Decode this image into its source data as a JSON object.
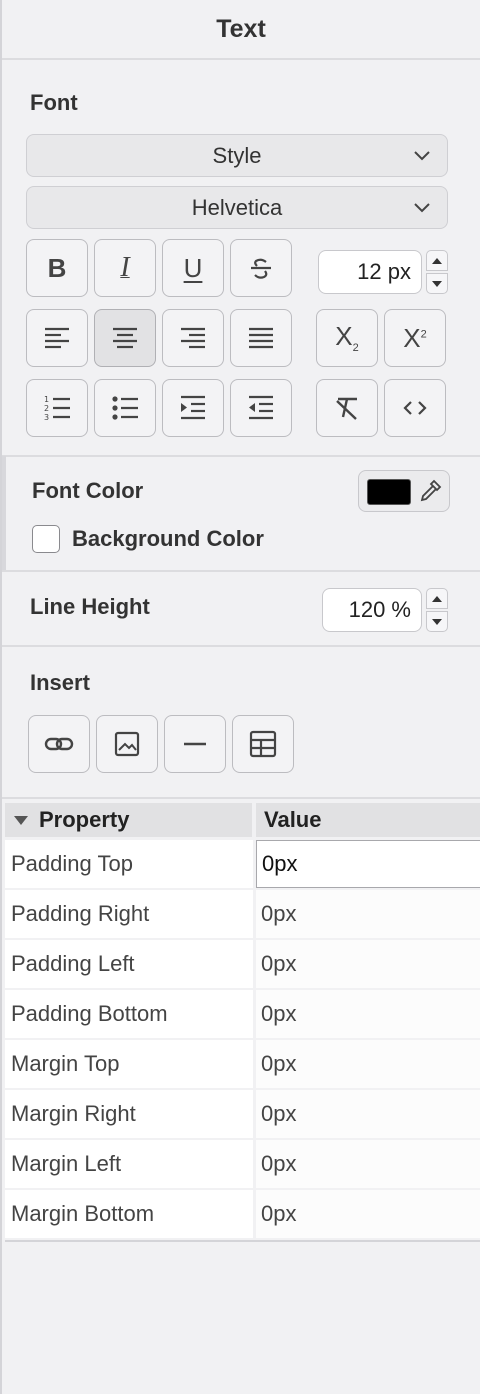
{
  "panel": {
    "title": "Text"
  },
  "font": {
    "section_label": "Font",
    "style_dropdown": "Style",
    "family_dropdown": "Helvetica",
    "size_value": "12 px",
    "icons_row1": [
      "bold-icon",
      "italic-icon",
      "underline-icon",
      "strikethrough-icon"
    ],
    "icons_row2": [
      "align-left-icon",
      "align-center-icon",
      "align-right-icon",
      "justify-icon",
      "subscript-icon",
      "superscript-icon"
    ],
    "icons_row3": [
      "numbered-list-icon",
      "bullet-list-icon",
      "indent-icon",
      "outdent-icon",
      "clear-format-icon",
      "html-code-icon"
    ],
    "bold_glyph": "B",
    "italic_glyph": "I",
    "underline_glyph": "U",
    "subscript_glyph": "X",
    "subscript_small": "2",
    "superscript_glyph": "X",
    "superscript_small": "2"
  },
  "colors": {
    "font_color_label": "Font Color",
    "font_color_value": "#000000",
    "background_color_label": "Background Color",
    "background_checked": false
  },
  "line_height": {
    "label": "Line Height",
    "value": "120 %"
  },
  "insert": {
    "label": "Insert",
    "icons": [
      "link-icon",
      "image-icon",
      "horizontal-rule-icon",
      "table-icon"
    ]
  },
  "properties": {
    "header_property": "Property",
    "header_value": "Value",
    "rows": [
      {
        "key": "Padding Top",
        "value": "0px"
      },
      {
        "key": "Padding Right",
        "value": "0px"
      },
      {
        "key": "Padding Left",
        "value": "0px"
      },
      {
        "key": "Padding Bottom",
        "value": "0px"
      },
      {
        "key": "Margin Top",
        "value": "0px"
      },
      {
        "key": "Margin Right",
        "value": "0px"
      },
      {
        "key": "Margin Left",
        "value": "0px"
      },
      {
        "key": "Margin Bottom",
        "value": "0px"
      }
    ]
  }
}
